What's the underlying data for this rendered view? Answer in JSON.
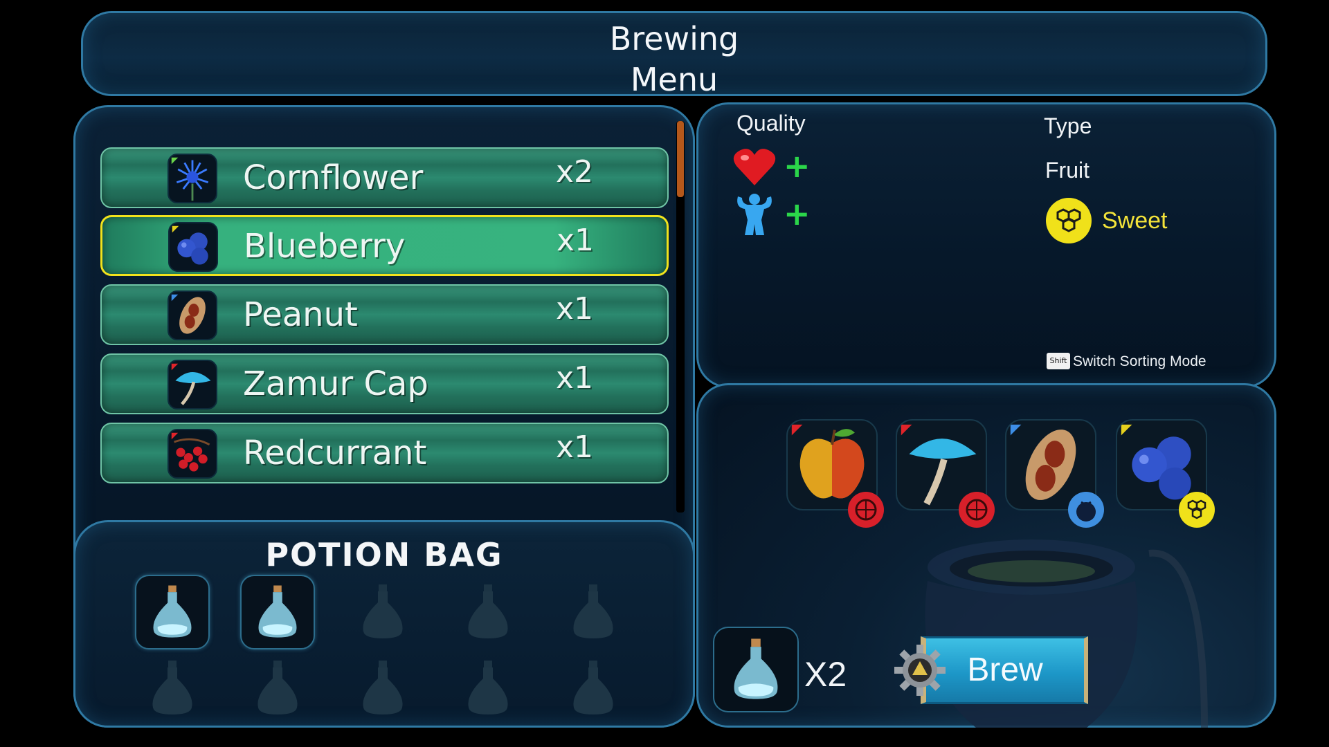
{
  "title": {
    "line1": "Brewing",
    "line2": "Menu"
  },
  "ingredients": [
    {
      "name": "Cornflower",
      "qty": "x2",
      "icon": "cornflower-icon",
      "corner": "#6bd34a"
    },
    {
      "name": "Blueberry",
      "qty": "x1",
      "icon": "blueberry-icon",
      "corner": "#e6d11e",
      "selected": true
    },
    {
      "name": "Peanut",
      "qty": "x1",
      "icon": "peanut-icon",
      "corner": "#3d8ee6"
    },
    {
      "name": "Zamur Cap",
      "qty": "x1",
      "icon": "mushroom-icon",
      "corner": "#e0242a"
    },
    {
      "name": "Redcurrant",
      "qty": "x1",
      "icon": "redcurrant-icon",
      "corner": "#e0242a"
    }
  ],
  "potion_bag": {
    "title": "POTION BAG",
    "filled_slots": 2,
    "total_slots": 10
  },
  "info": {
    "quality_label": "Quality",
    "type_label": "Type",
    "type_value": "Fruit",
    "flavor": "Sweet",
    "quality_icons": [
      "heart-icon",
      "strength-icon"
    ],
    "plus": "+",
    "shift_key": "Shift",
    "sort_hint": "Switch Sorting Mode"
  },
  "selected_ingredients": [
    {
      "icon": "apple-icon",
      "corner": "#e0242a",
      "flavor_icon": "sour-icon",
      "flavor_color": "#d8202a"
    },
    {
      "icon": "mushroom-icon",
      "corner": "#e0242a",
      "flavor_icon": "sour-icon",
      "flavor_color": "#d8202a"
    },
    {
      "icon": "peanut-icon",
      "corner": "#3d8ee6",
      "flavor_icon": "bitter-icon",
      "flavor_color": "#3f8fe0"
    },
    {
      "icon": "blueberry-icon",
      "corner": "#e6d11e",
      "flavor_icon": "sweet-icon",
      "flavor_color": "#f0e11a"
    }
  ],
  "result": {
    "qty": "X2",
    "icon": "potion-icon"
  },
  "brew_button": {
    "label": "Brew"
  },
  "colors": {
    "accent": "#2f79a3",
    "row": "#22705b",
    "selected_border": "#f1e21c",
    "sweet": "#f4e43a",
    "plus": "#2bd64a"
  }
}
